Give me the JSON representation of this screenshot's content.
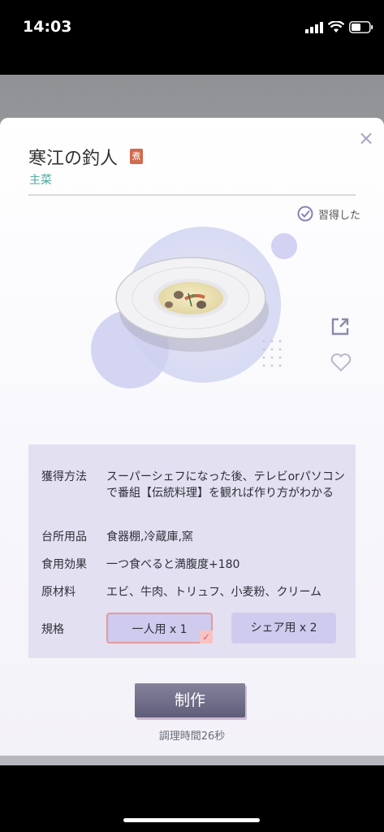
{
  "status_bar": {
    "time": "14:03",
    "icons": [
      "signal-icon",
      "wifi-icon",
      "battery-icon"
    ]
  },
  "recipe": {
    "title": "寒江の釣人",
    "method_badge": "煮",
    "category": "主菜",
    "learned_label": "習得した"
  },
  "info": {
    "rows": [
      {
        "key": "獲得方法",
        "value": "スーパーシェフになった後、テレビorパソコンで番組【伝統料理】を観れば作り方がわかる"
      },
      {
        "key": "台所用品",
        "value": "食器棚,冷蔵庫,窯"
      },
      {
        "key": "食用効果",
        "value": "一つ食べると満腹度+180"
      },
      {
        "key": "原材料",
        "value": "エビ、牛肉、トリュフ、小麦粉、クリーム"
      },
      {
        "key": "規格",
        "value": ""
      }
    ],
    "specs": [
      {
        "label": "一人用 x 1",
        "selected": true
      },
      {
        "label": "シェア用 x 2",
        "selected": false
      }
    ]
  },
  "actions": {
    "make_label": "制作",
    "cook_time": "調理時間26秒"
  },
  "colors": {
    "accent": "#4fa7a0",
    "panel": "#e2e0f1",
    "button": "#6f6d88"
  }
}
